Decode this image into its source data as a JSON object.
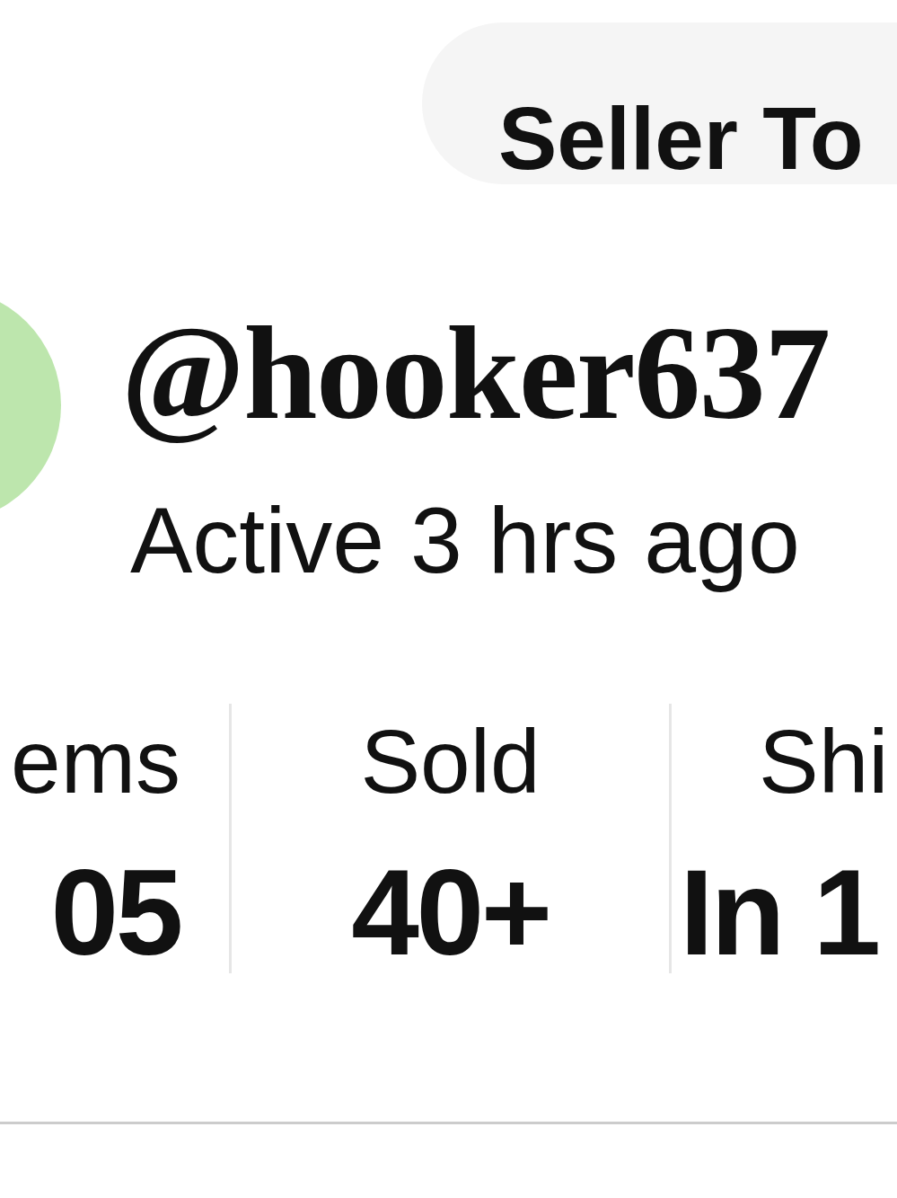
{
  "header": {
    "button": {
      "label": "Seller To"
    }
  },
  "profile": {
    "username": "@hooker637",
    "activity": "Active 3 hrs ago"
  },
  "stats": [
    {
      "label": "ems",
      "value": "05"
    },
    {
      "label": "Sold",
      "value": "40+"
    },
    {
      "label": "Shi",
      "value": "In 1"
    }
  ]
}
